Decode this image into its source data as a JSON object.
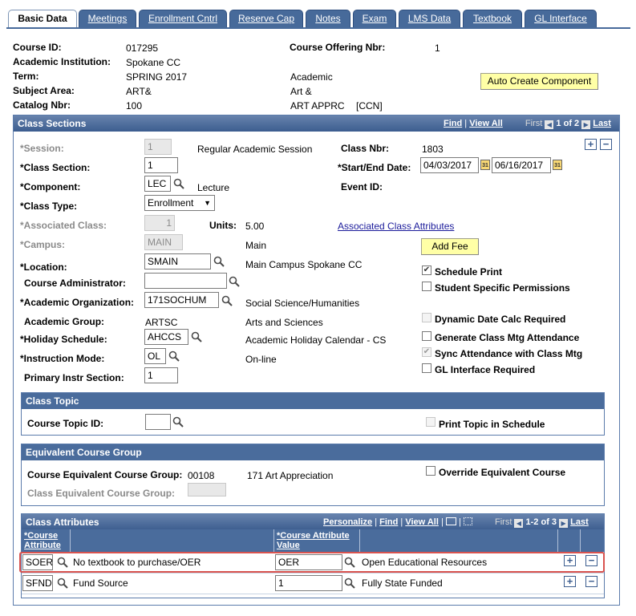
{
  "tabs": [
    {
      "label": "Basic Data",
      "active": true
    },
    {
      "label": "Meetings"
    },
    {
      "label": "Enrollment Cntrl"
    },
    {
      "label": "Reserve Cap"
    },
    {
      "label": "Notes"
    },
    {
      "label": "Exam"
    },
    {
      "label": "LMS Data"
    },
    {
      "label": "Textbook"
    },
    {
      "label": "GL Interface"
    }
  ],
  "header": {
    "course_id_label": "Course ID:",
    "course_id": "017295",
    "offering_label": "Course Offering Nbr:",
    "offering": "1",
    "institution_label": "Academic Institution:",
    "institution": "Spokane CC",
    "term_label": "Term:",
    "term": "SPRING 2017",
    "career": "Academic",
    "subject_label": "Subject Area:",
    "subject": "ART&",
    "subject_desc": "Art &",
    "catalog_label": "Catalog Nbr:",
    "catalog": "100",
    "catalog_desc": "ART APPRC",
    "catalog_tag": "[CCN]",
    "auto_create_label": "Auto Create Component"
  },
  "class_sections": {
    "title": "Class Sections",
    "find": "Find",
    "view_all": "View All",
    "first": "First",
    "count": "1 of 2",
    "last": "Last",
    "session_label": "*Session:",
    "session": "1",
    "session_desc": "Regular Academic Session",
    "class_nbr_label": "Class Nbr:",
    "class_nbr": "1803",
    "class_section_label": "*Class Section:",
    "class_section": "1",
    "start_end_label": "*Start/End Date:",
    "start_date": "04/03/2017",
    "end_date": "06/16/2017",
    "component_label": "*Component:",
    "component": "LEC",
    "component_desc": "Lecture",
    "event_id_label": "Event ID:",
    "class_type_label": "*Class Type:",
    "class_type": "Enrollment",
    "assoc_class_label": "*Associated Class:",
    "assoc_class": "1",
    "units_label": "Units:",
    "units": "5.00",
    "assoc_attr_link": "Associated Class Attributes",
    "campus_label": "*Campus:",
    "campus": "MAIN",
    "campus_desc": "Main",
    "add_fee_label": "Add Fee",
    "location_label": "*Location:",
    "location": "SMAIN",
    "location_desc": "Main Campus Spokane CC",
    "schedule_print_label": "Schedule Print",
    "course_admin_label": "Course Administrator:",
    "student_perm_label": "Student Specific Permissions",
    "acad_org_label": "*Academic Organization:",
    "acad_org": "171SOCHUM",
    "acad_org_desc": "Social Science/Humanities",
    "dyn_date_label": "Dynamic Date Calc Required",
    "acad_group_label": "Academic Group:",
    "acad_group": "ARTSC",
    "acad_group_desc": "Arts and Sciences",
    "gen_mtg_label": "Generate Class Mtg Attendance",
    "holiday_label": "*Holiday Schedule:",
    "holiday": "AHCCS",
    "holiday_desc": "Academic Holiday Calendar - CS",
    "sync_label": "Sync Attendance with Class Mtg",
    "instr_mode_label": "*Instruction Mode:",
    "instr_mode": "OL",
    "instr_mode_desc": "On-line",
    "gl_label": "GL Interface Required",
    "primary_instr_label": "Primary Instr Section:",
    "primary_instr": "1"
  },
  "class_topic": {
    "title": "Class Topic",
    "topic_label": "Course Topic ID:",
    "print_topic_label": "Print Topic in Schedule"
  },
  "equiv_group": {
    "title": "Equivalent Course Group",
    "course_equiv_label": "Course Equivalent Course Group:",
    "course_equiv": "00108",
    "course_equiv_desc": "171 Art Appreciation",
    "override_label": "Override Equivalent Course",
    "class_equiv_label": "Class Equivalent Course Group:"
  },
  "class_attributes": {
    "title": "Class Attributes",
    "personalize": "Personalize",
    "find": "Find",
    "view_all": "View All",
    "first": "First",
    "count": "1-2 of 3",
    "last": "Last",
    "col_attr": "*Course Attribute",
    "col_value": "*Course Attribute Value",
    "rows": [
      {
        "attr": "SOER",
        "attr_desc": "No textbook to purchase/OER",
        "value": "OER",
        "value_desc": "Open Educational Resources"
      },
      {
        "attr": "SFND",
        "attr_desc": "Fund Source",
        "value": "1",
        "value_desc": "Fully State Funded"
      }
    ]
  },
  "colors": {
    "header_blue": "#4a6c9c",
    "highlight_red": "#d9534f",
    "button_yellow": "#ffffa6"
  }
}
